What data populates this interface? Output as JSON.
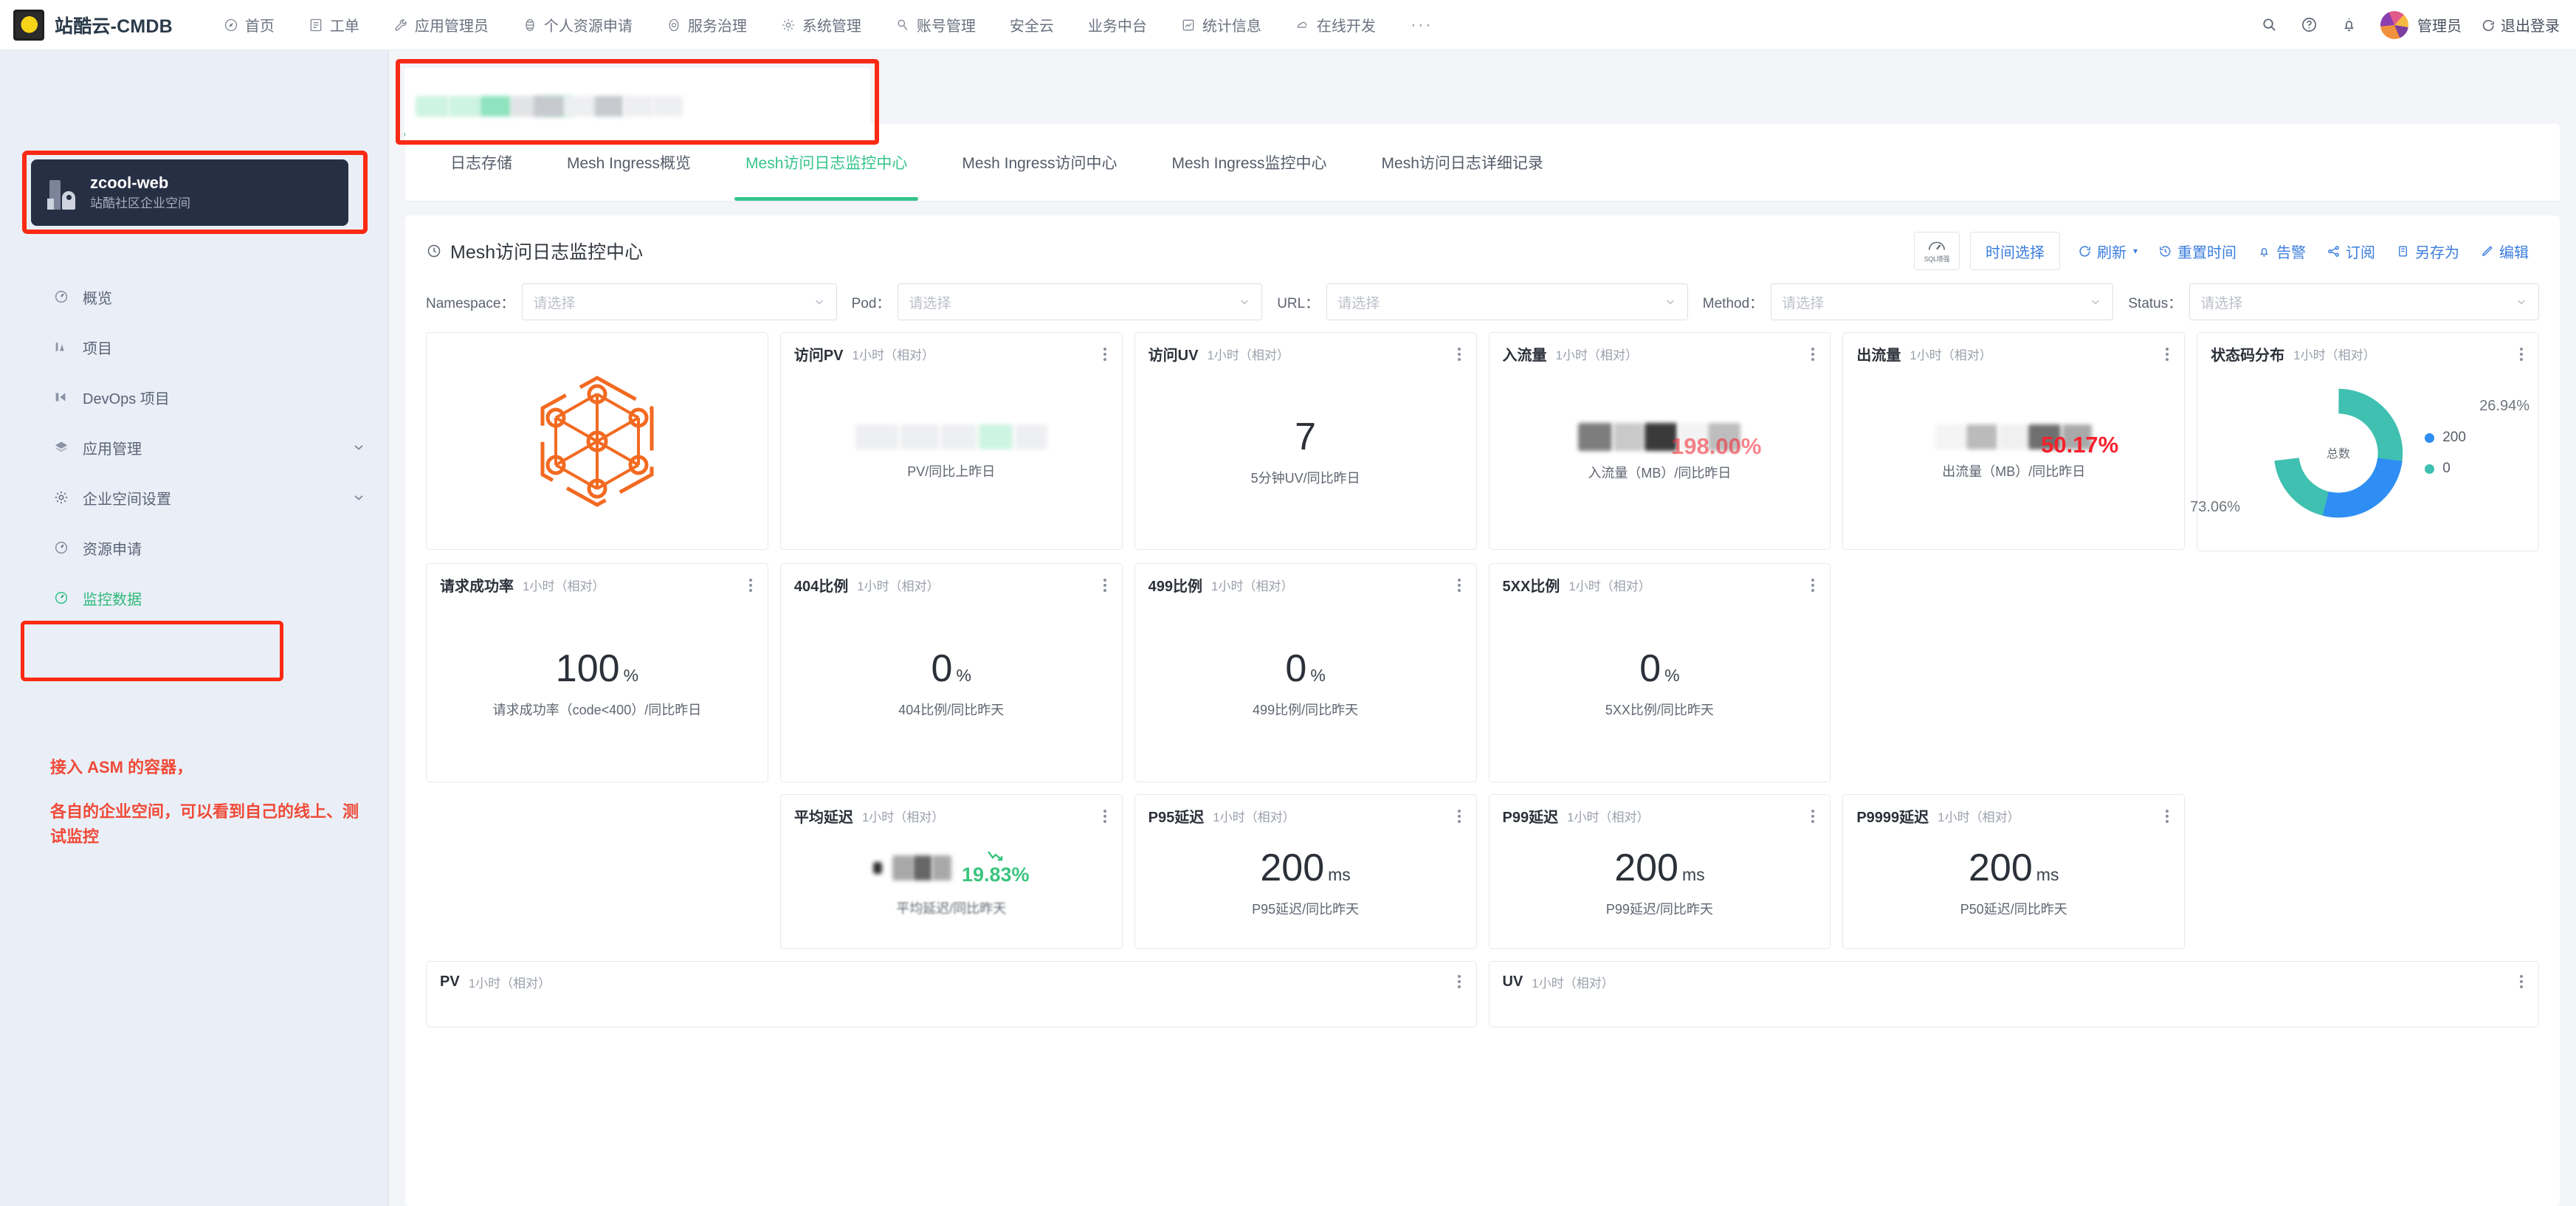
{
  "topnav": {
    "brand": "站酷云-CMDB",
    "links": [
      {
        "label": "首页",
        "icon": "compass-icon"
      },
      {
        "label": "工单",
        "icon": "ticket-icon"
      },
      {
        "label": "应用管理员",
        "icon": "wrench-icon"
      },
      {
        "label": "个人资源申请",
        "icon": "globe-icon"
      },
      {
        "label": "服务治理",
        "icon": "gear-circle-icon"
      },
      {
        "label": "系统管理",
        "icon": "gear-icon"
      },
      {
        "label": "账号管理",
        "icon": "key-icon"
      },
      {
        "label": "安全云",
        "icon": "none"
      },
      {
        "label": "业务中台",
        "icon": "none"
      },
      {
        "label": "统计信息",
        "icon": "chart-box-icon"
      },
      {
        "label": "在线开发",
        "icon": "cloud-icon"
      }
    ],
    "more": "···",
    "user_name": "管理员",
    "logout_label": "退出登录"
  },
  "sidebar": {
    "workspace": {
      "name": "zcool-web",
      "subtitle": "站酷社区企业空间"
    },
    "items": [
      {
        "label": "概览",
        "icon": "gauge-icon",
        "expandable": false,
        "active": false
      },
      {
        "label": "项目",
        "icon": "project-icon",
        "expandable": false,
        "active": false
      },
      {
        "label": "DevOps 项目",
        "icon": "devops-icon",
        "expandable": false,
        "active": false
      },
      {
        "label": "应用管理",
        "icon": "layers-icon",
        "expandable": true,
        "active": false
      },
      {
        "label": "企业空间设置",
        "icon": "gear-icon",
        "expandable": true,
        "active": false
      },
      {
        "label": "资源申请",
        "icon": "gauge-icon",
        "expandable": false,
        "active": false
      },
      {
        "label": "监控数据",
        "icon": "gauge-icon",
        "expandable": false,
        "active": true
      }
    ],
    "note_line1": "接入 ASM 的容器，",
    "note_line2": "各自的企业空间，可以看到自己的线上、测试监控"
  },
  "tabs": [
    {
      "label": "日志存储",
      "active": false
    },
    {
      "label": "Mesh Ingress概览",
      "active": false
    },
    {
      "label": "Mesh访问日志监控中心",
      "active": true
    },
    {
      "label": "Mesh Ingress访问中心",
      "active": false
    },
    {
      "label": "Mesh Ingress监控中心",
      "active": false
    },
    {
      "label": "Mesh访问日志详细记录",
      "active": false
    }
  ],
  "dashboard": {
    "title": "Mesh访问日志监控中心",
    "toolbar": {
      "sql_label": "SQL增强",
      "time_select": "时间选择",
      "refresh": "刷新",
      "reset_time": "重置时间",
      "alert": "告警",
      "subscribe": "订阅",
      "save_as": "另存为",
      "edit": "编辑"
    },
    "filters": [
      {
        "label": "Namespace：",
        "placeholder": "请选择"
      },
      {
        "label": "Pod：",
        "placeholder": "请选择"
      },
      {
        "label": "URL：",
        "placeholder": "请选择"
      },
      {
        "label": "Method：",
        "placeholder": "请选择"
      },
      {
        "label": "Status：",
        "placeholder": "请选择"
      }
    ],
    "range_label": "1小时（相对）",
    "cards": [
      {
        "title": "访问PV",
        "range": "1小时（相对）",
        "value": "",
        "unit": "",
        "caption": "PV/同比上昨日",
        "redacted": true,
        "delta": "",
        "delta_kind": "none"
      },
      {
        "title": "访问UV",
        "range": "1小时（相对）",
        "value": "7",
        "unit": "",
        "caption": "5分钟UV/同比昨日",
        "redacted": false,
        "delta": "",
        "delta_kind": "none"
      },
      {
        "title": "入流量",
        "range": "1小时（相对）",
        "value": "",
        "unit": "",
        "caption": "入流量（MB）/同比昨日",
        "redacted": true,
        "delta": "198.00%",
        "delta_kind": "red"
      },
      {
        "title": "出流量",
        "range": "1小时（相对）",
        "value": "",
        "unit": "",
        "caption": "出流量（MB）/同比昨日",
        "redacted": true,
        "delta": "50.17%",
        "delta_kind": "red"
      },
      {
        "title": "请求成功率",
        "range": "1小时（相对）",
        "value": "100",
        "unit": "%",
        "caption": "请求成功率（code<400）/同比昨日",
        "redacted": false,
        "delta": "",
        "delta_kind": "none"
      },
      {
        "title": "404比例",
        "range": "1小时（相对）",
        "value": "0",
        "unit": "%",
        "caption": "404比例/同比昨天",
        "redacted": false,
        "delta": "",
        "delta_kind": "none"
      },
      {
        "title": "499比例",
        "range": "1小时（相对）",
        "value": "0",
        "unit": "%",
        "caption": "499比例/同比昨天",
        "redacted": false,
        "delta": "",
        "delta_kind": "none"
      },
      {
        "title": "5XX比例",
        "range": "1小时（相对）",
        "value": "0",
        "unit": "%",
        "caption": "5XX比例/同比昨天",
        "redacted": false,
        "delta": "",
        "delta_kind": "none"
      },
      {
        "title": "平均延迟",
        "range": "1小时（相对）",
        "value": "",
        "unit": "",
        "caption": "平均延迟/同比昨天",
        "redacted": true,
        "delta": "19.83%",
        "delta_kind": "green"
      },
      {
        "title": "P95延迟",
        "range": "1小时（相对）",
        "value": "200",
        "unit": "ms",
        "caption": "P95延迟/同比昨天",
        "redacted": false,
        "delta": "",
        "delta_kind": "none"
      },
      {
        "title": "P99延迟",
        "range": "1小时（相对）",
        "value": "200",
        "unit": "ms",
        "caption": "P99延迟/同比昨天",
        "redacted": false,
        "delta": "",
        "delta_kind": "none"
      },
      {
        "title": "P9999延迟",
        "range": "1小时（相对）",
        "value": "200",
        "unit": "ms",
        "caption": "P50延迟/同比昨天",
        "redacted": false,
        "delta": "",
        "delta_kind": "none"
      }
    ],
    "status_card": {
      "title": "状态码分布",
      "range": "1小时（相对）",
      "center_label": "总数"
    },
    "bottom_panels": [
      {
        "title": "PV",
        "range": "1小时（相对）"
      },
      {
        "title": "UV",
        "range": "1小时（相对）"
      }
    ]
  },
  "chart_data": {
    "type": "pie",
    "title": "状态码分布",
    "labels": [
      "200",
      "0"
    ],
    "values": [
      26.94,
      73.06
    ],
    "value_labels": [
      "26.94%",
      "73.06%"
    ],
    "colors": [
      "#2f8ef4",
      "#3fc0b0"
    ],
    "center_label": "总数",
    "legend": "right",
    "donut": true
  },
  "colors": {
    "accent_green": "#35c48c",
    "accent_blue": "#3b7ddd",
    "annotation_red": "#fa2a14",
    "note_red": "#ef4a38",
    "status_200": "#2f8ef4",
    "status_0": "#3fc0b0",
    "delta_red": "#f5222d",
    "delta_green": "#3ac57f",
    "sidebar_bg": "#eaeff7",
    "workspace_bg": "#272f45"
  }
}
